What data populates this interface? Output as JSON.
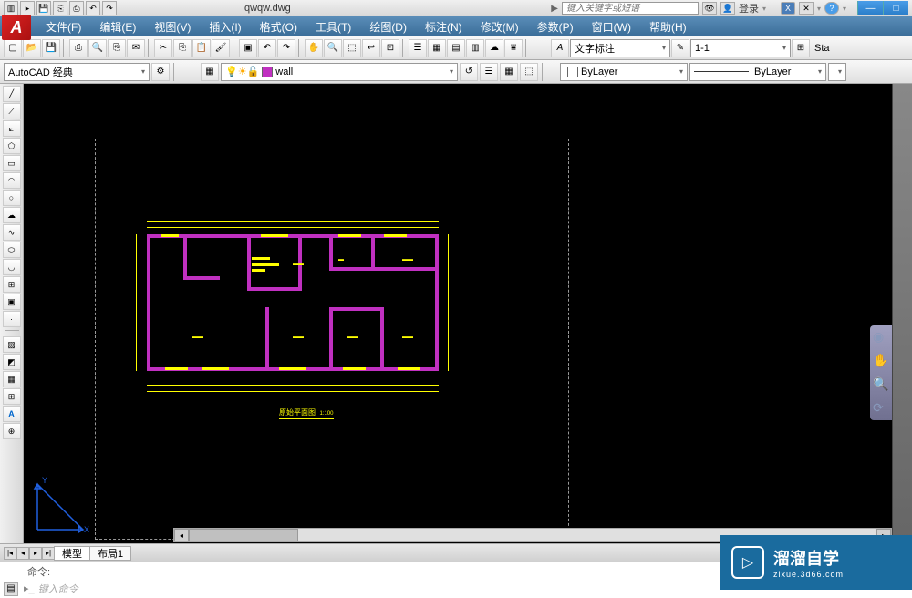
{
  "title": "qwqw.dwg",
  "search_placeholder": "键入关键字或短语",
  "login_label": "登录",
  "menus": [
    "文件(F)",
    "编辑(E)",
    "视图(V)",
    "插入(I)",
    "格式(O)",
    "工具(T)",
    "绘图(D)",
    "标注(N)",
    "修改(M)",
    "参数(P)",
    "窗口(W)",
    "帮助(H)"
  ],
  "workspace": "AutoCAD 经典",
  "layer_name": "wall",
  "props": {
    "color": "ByLayer",
    "linetype": "ByLayer"
  },
  "annotation_style": "文字标注",
  "scale": "1-1",
  "sta_label": "Sta",
  "tabs": {
    "model": "模型",
    "layout1": "布局1"
  },
  "cmd_hist": "命令:",
  "cmd_placeholder": "键入命令",
  "plan_title": "原始平面图",
  "plan_scale": "1:100",
  "watermark": {
    "main": "溜溜自学",
    "sub": "zixue.3d66.com"
  }
}
